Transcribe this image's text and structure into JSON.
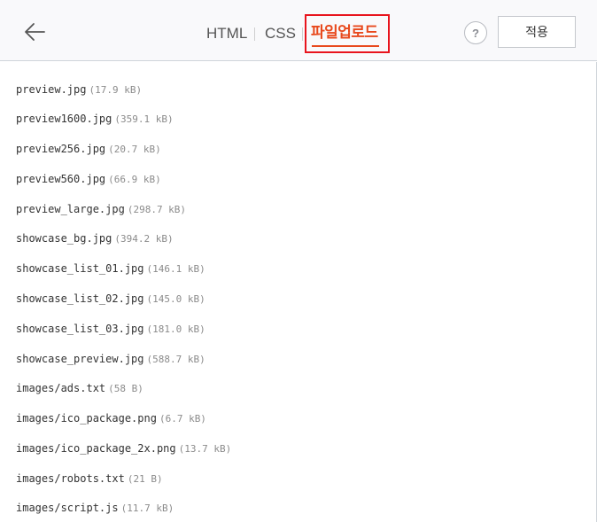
{
  "header": {
    "tabs": [
      {
        "label": "HTML"
      },
      {
        "label": "CSS"
      },
      {
        "label": "파일업로드"
      }
    ],
    "help_label": "?",
    "apply_label": "적용"
  },
  "colors": {
    "active_tab": "#e8491d",
    "highlight_box": "#e8141d"
  },
  "files": [
    {
      "name": "preview.jpg",
      "size": "(17.9 kB)"
    },
    {
      "name": "preview1600.jpg",
      "size": "(359.1 kB)"
    },
    {
      "name": "preview256.jpg",
      "size": "(20.7 kB)"
    },
    {
      "name": "preview560.jpg",
      "size": "(66.9 kB)"
    },
    {
      "name": "preview_large.jpg",
      "size": "(298.7 kB)"
    },
    {
      "name": "showcase_bg.jpg",
      "size": "(394.2 kB)"
    },
    {
      "name": "showcase_list_01.jpg",
      "size": "(146.1 kB)"
    },
    {
      "name": "showcase_list_02.jpg",
      "size": "(145.0 kB)"
    },
    {
      "name": "showcase_list_03.jpg",
      "size": "(181.0 kB)"
    },
    {
      "name": "showcase_preview.jpg",
      "size": "(588.7 kB)"
    },
    {
      "name": "images/ads.txt",
      "size": "(58 B)"
    },
    {
      "name": "images/ico_package.png",
      "size": "(6.7 kB)"
    },
    {
      "name": "images/ico_package_2x.png",
      "size": "(13.7 kB)"
    },
    {
      "name": "images/robots.txt",
      "size": "(21 B)"
    },
    {
      "name": "images/script.js",
      "size": "(11.7 kB)"
    }
  ]
}
